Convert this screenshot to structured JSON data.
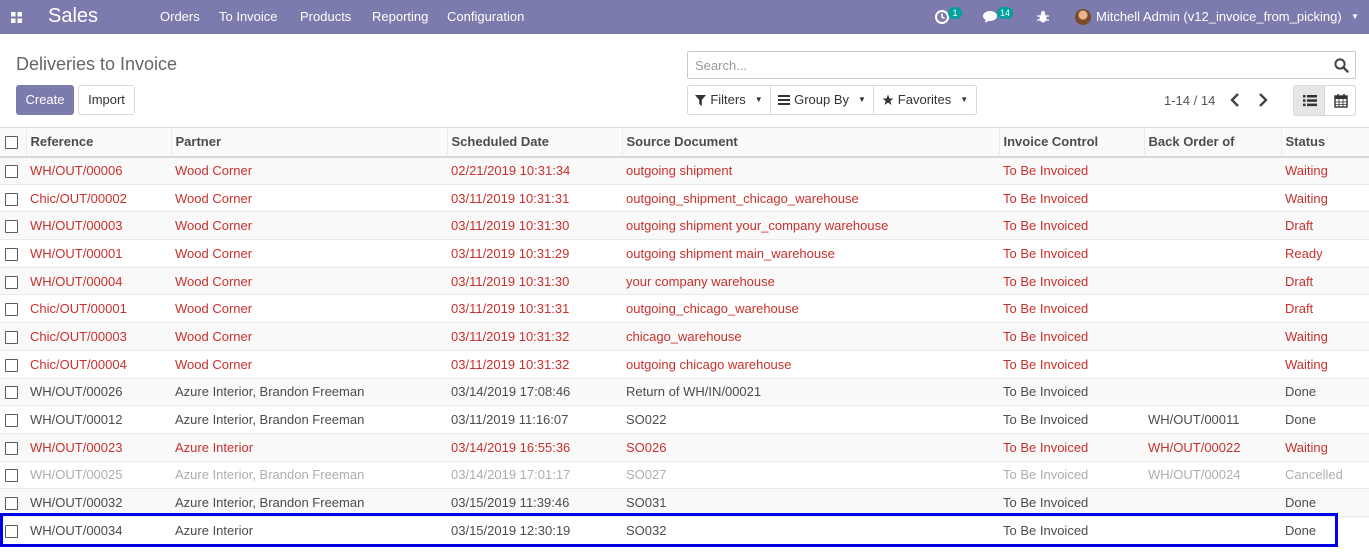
{
  "navbar": {
    "app_name": "Sales",
    "menu": [
      "Orders",
      "To Invoice",
      "Products",
      "Reporting",
      "Configuration"
    ],
    "activity_count": "1",
    "messages_count": "14",
    "user": "Mitchell Admin (v12_invoice_from_picking)",
    "bg_color": "#7c7bad",
    "icons": [
      "apps-icon",
      "activity-clock-icon",
      "chat-icon",
      "bug-icon",
      "avatar",
      "chevron-down-icon"
    ]
  },
  "control_panel": {
    "breadcrumb": "Deliveries to Invoice",
    "create_label": "Create",
    "import_label": "Import",
    "search_placeholder": "Search...",
    "search_value": "",
    "filters_label": "Filters",
    "group_by_label": "Group By",
    "favorites_label": "Favorites",
    "pager": "1-14 / 14",
    "views": [
      "list-view",
      "calendar-view"
    ],
    "active_view": "list-view"
  },
  "table": {
    "columns": [
      "Reference",
      "Partner",
      "Scheduled Date",
      "Source Document",
      "Invoice Control",
      "Back Order of",
      "Status"
    ],
    "rows": [
      {
        "cells": [
          "WH/OUT/00006",
          "Wood Corner",
          "02/21/2019 10:31:34",
          "outgoing shipment",
          "To Be Invoiced",
          "",
          "Waiting"
        ],
        "style": "red"
      },
      {
        "cells": [
          "Chic/OUT/00002",
          "Wood Corner",
          "03/11/2019 10:31:31",
          "outgoing_shipment_chicago_warehouse",
          "To Be Invoiced",
          "",
          "Waiting"
        ],
        "style": "red"
      },
      {
        "cells": [
          "WH/OUT/00003",
          "Wood Corner",
          "03/11/2019 10:31:30",
          "outgoing shipment your_company warehouse",
          "To Be Invoiced",
          "",
          "Draft"
        ],
        "style": "red"
      },
      {
        "cells": [
          "WH/OUT/00001",
          "Wood Corner",
          "03/11/2019 10:31:29",
          "outgoing shipment main_warehouse",
          "To Be Invoiced",
          "",
          "Ready"
        ],
        "style": "red"
      },
      {
        "cells": [
          "WH/OUT/00004",
          "Wood Corner",
          "03/11/2019 10:31:30",
          "your company warehouse",
          "To Be Invoiced",
          "",
          "Draft"
        ],
        "style": "red"
      },
      {
        "cells": [
          "Chic/OUT/00001",
          "Wood Corner",
          "03/11/2019 10:31:31",
          "outgoing_chicago_warehouse",
          "To Be Invoiced",
          "",
          "Draft"
        ],
        "style": "red"
      },
      {
        "cells": [
          "Chic/OUT/00003",
          "Wood Corner",
          "03/11/2019 10:31:32",
          "chicago_warehouse",
          "To Be Invoiced",
          "",
          "Waiting"
        ],
        "style": "red"
      },
      {
        "cells": [
          "Chic/OUT/00004",
          "Wood Corner",
          "03/11/2019 10:31:32",
          "outgoing chicago warehouse",
          "To Be Invoiced",
          "",
          "Waiting"
        ],
        "style": "red"
      },
      {
        "cells": [
          "WH/OUT/00026",
          "Azure Interior, Brandon Freeman",
          "03/14/2019 17:08:46",
          "Return of WH/IN/00021",
          "To Be Invoiced",
          "",
          "Done"
        ],
        "style": "normal"
      },
      {
        "cells": [
          "WH/OUT/00012",
          "Azure Interior, Brandon Freeman",
          "03/11/2019 11:16:07",
          "SO022",
          "To Be Invoiced",
          "WH/OUT/00011",
          "Done"
        ],
        "style": "normal"
      },
      {
        "cells": [
          "WH/OUT/00023",
          "Azure Interior",
          "03/14/2019 16:55:36",
          "SO026",
          "To Be Invoiced",
          "WH/OUT/00022",
          "Waiting"
        ],
        "style": "red"
      },
      {
        "cells": [
          "WH/OUT/00025",
          "Azure Interior, Brandon Freeman",
          "03/14/2019 17:01:17",
          "SO027",
          "To Be Invoiced",
          "WH/OUT/00024",
          "Cancelled"
        ],
        "style": "muted"
      },
      {
        "cells": [
          "WH/OUT/00032",
          "Azure Interior, Brandon Freeman",
          "03/15/2019 11:39:46",
          "SO031",
          "To Be Invoiced",
          "",
          "Done"
        ],
        "style": "normal"
      },
      {
        "cells": [
          "WH/OUT/00034",
          "Azure Interior",
          "03/15/2019 12:30:19",
          "SO032",
          "To Be Invoiced",
          "",
          "Done"
        ],
        "style": "normal",
        "highlighted": true
      }
    ]
  },
  "colors": {
    "brand": "#7c7bad",
    "late_row_text": "#c9302c",
    "cancelled_row_text": "#aeaeae",
    "badge": "#00a09d",
    "highlight_box": "#0000e6"
  }
}
